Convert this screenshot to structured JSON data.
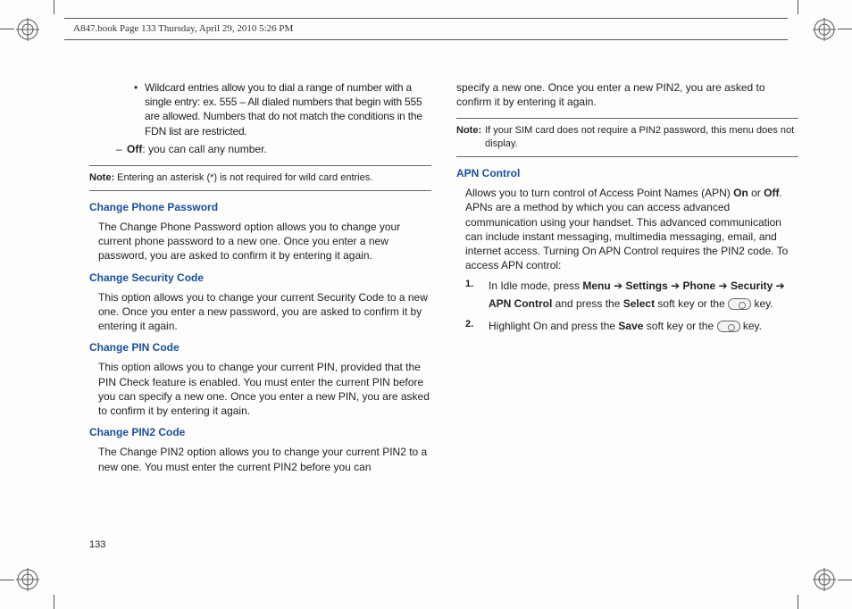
{
  "header": {
    "running": "A847.book  Page 133  Thursday, April 29, 2010  5:26 PM"
  },
  "left": {
    "bullet": "Wildcard entries allow you to dial a range of number with a single entry: ex. 555 – All dialed numbers that begin with 555 are allowed. Numbers that do not match the conditions in the FDN list are restricted.",
    "dash_off_label": "Off",
    "dash_off_rest": ": you can call any number.",
    "note1_label": "Note:",
    "note1_text": " Entering an asterisk (*) is not required for wild card entries.",
    "h_changepwd": "Change Phone Password",
    "p_changepwd": "The Change Phone Password option allows you to change your current phone password to a new one. Once you enter a new password, you are asked to confirm it by entering it again.",
    "h_seccode": "Change Security Code",
    "p_seccode": "This option allows you to change your current Security Code to a new one. Once you enter a new password, you are asked to confirm it by entering it again.",
    "h_pin": "Change PIN Code",
    "p_pin": "This option allows you to change your current PIN, provided that the PIN Check feature is enabled. You must enter the current PIN before you can specify a new one. Once you enter a new PIN, you are asked to confirm it by entering it again.",
    "h_pin2": "Change PIN2 Code",
    "p_pin2": "The Change PIN2 option allows you to change your current PIN2 to a new one. You must enter the current PIN2 before you can"
  },
  "right": {
    "p_cont": "specify a new one. Once you enter a new PIN2, you are asked to confirm it by entering it again.",
    "note2_label": "Note:",
    "note2_text": "If your SIM card does not require a PIN2 password, this menu does not display.",
    "h_apn": "APN Control",
    "p_apn_a": "Allows you to turn control of Access Point Names (APN) ",
    "p_apn_on": "On",
    "p_apn_mid": " or ",
    "p_apn_off": "Off",
    "p_apn_b": ". APNs are a method by which you can access advanced communication using your handset. This advanced communication can include instant messaging, multimedia messaging, email, and internet access. Turning On APN Control requires the PIN2 code. To access APN control:",
    "step1_num": "1.",
    "step1_a": "In Idle mode, press ",
    "step1_menu": "Menu",
    "step1_arrow": " ➔ ",
    "step1_settings": "Settings",
    "step1_phone": "Phone",
    "step1_security": "Security",
    "step1_apn": "APN Control",
    "step1_b": " and press the ",
    "step1_select": "Select",
    "step1_c": " soft key or the ",
    "step1_d": " key.",
    "step2_num": "2.",
    "step2_a": "Highlight On and press the ",
    "step2_save": "Save",
    "step2_b": " soft key or the ",
    "step2_c": " key."
  },
  "pagenum": "133"
}
